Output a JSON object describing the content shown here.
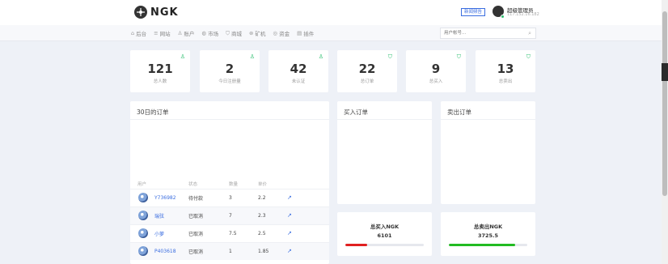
{
  "header": {
    "logo_text": "NGK",
    "system_button": "新闻频告",
    "admin_name": "超级管理员",
    "admin_ip": "117.152.16.182"
  },
  "nav": {
    "items": [
      {
        "icon": "⌂",
        "label": "后台"
      },
      {
        "icon": "≡",
        "label": "网站"
      },
      {
        "icon": "♙",
        "label": "账户"
      },
      {
        "icon": "◍",
        "label": "市场"
      },
      {
        "icon": "⛉",
        "label": "商城"
      },
      {
        "icon": "⊛",
        "label": "矿机"
      },
      {
        "icon": "◎",
        "label": "资金"
      },
      {
        "icon": "▤",
        "label": "插件"
      }
    ],
    "search_placeholder": "用户帐号..."
  },
  "stats": [
    {
      "value": "121",
      "label": "总人数",
      "icon": "♙"
    },
    {
      "value": "2",
      "label": "今日注册量",
      "icon": "♙"
    },
    {
      "value": "42",
      "label": "未认证",
      "icon": "♙"
    },
    {
      "value": "22",
      "label": "总订单",
      "icon": "⛉"
    },
    {
      "value": "9",
      "label": "总买入",
      "icon": "⛉"
    },
    {
      "value": "13",
      "label": "总卖出",
      "icon": "⛉"
    }
  ],
  "orders_panel": {
    "title": "30日的订单",
    "columns": [
      "用户",
      "状态",
      "数量",
      "单价"
    ],
    "rows": [
      {
        "user": "Y736982",
        "status": "待付款",
        "qty": "3",
        "price": "2.2",
        "action": "↗"
      },
      {
        "user": "瑞弦",
        "status": "已取消",
        "qty": "7",
        "price": "2.3",
        "action": "↗"
      },
      {
        "user": "小萝",
        "status": "已取消",
        "qty": "7.5",
        "price": "2.5",
        "action": "↗"
      },
      {
        "user": "P403618",
        "status": "已取消",
        "qty": "1",
        "price": "1.85",
        "action": "↗"
      }
    ]
  },
  "buy_panel": {
    "title": "买入订单"
  },
  "sell_panel": {
    "title": "卖出订单"
  },
  "buy_summary": {
    "title": "总买入NGK",
    "value": "6101",
    "bar_fraction": 0.28,
    "bar_color": "#e02020"
  },
  "sell_summary": {
    "title": "总卖出NGK",
    "value": "3725.5",
    "bar_fraction": 0.85,
    "bar_color": "#22bb22"
  },
  "colors": {
    "accent": "#3a6de0",
    "green": "#2fbf71",
    "background": "#eef1f7"
  }
}
